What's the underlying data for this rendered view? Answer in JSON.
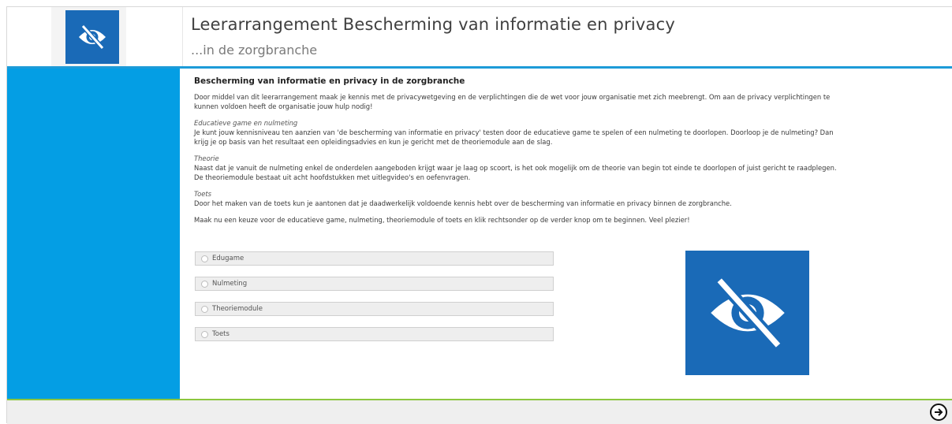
{
  "header": {
    "title": "Leerarrangement Bescherming van informatie en privacy",
    "subtitle": "...in de zorgbranche",
    "logo_icon": "eye-slash-icon"
  },
  "content": {
    "heading": "Bescherming van informatie en privacy in de zorgbranche",
    "intro": "Door middel van dit leerarrangement maak je kennis met de privacywetgeving en de verplichtingen die de wet voor jouw organisatie met zich meebrengt. Om aan de privacy verplichtingen te kunnen voldoen heeft de organisatie jouw hulp nodig!",
    "sections": [
      {
        "title": "Educatieve game en nulmeting",
        "text": "Je kunt jouw kennisniveau ten aanzien van 'de bescherming van informatie en privacy' testen door de educatieve game te spelen of een nulmeting te doorlopen. Doorloop je de nulmeting? Dan krijg je op basis van het resultaat een opleidingsadvies en kun je gericht met de theoriemodule aan de slag."
      },
      {
        "title": "Theorie",
        "text": "Naast dat je vanuit de nulmeting enkel de onderdelen aangeboden krijgt waar je laag op scoort, is het ook mogelijk om de theorie van begin tot einde te doorlopen of juist gericht te raadplegen. De theoriemodule bestaat uit acht hoofdstukken met uitlegvideo's en oefenvragen."
      },
      {
        "title": "Toets",
        "text": "Door het maken van de toets kun je aantonen dat je daadwerkelijk voldoende kennis hebt over de bescherming van informatie en privacy binnen de zorgbranche."
      }
    ],
    "closing": "Maak nu een keuze voor de educatieve game, nulmeting, theoriemodule of toets en klik rechtsonder op de verder knop om te beginnen. Veel plezier!"
  },
  "options": [
    "Edugame",
    "Nulmeting",
    "Theoriemodule",
    "Toets"
  ],
  "footer": {
    "next_icon": "arrow-right-circle-icon"
  },
  "colors": {
    "sidebar": "#049ee4",
    "logo": "#1a6ab7",
    "header_line": "#1d9bd8",
    "footer_line": "#8cc63f"
  }
}
